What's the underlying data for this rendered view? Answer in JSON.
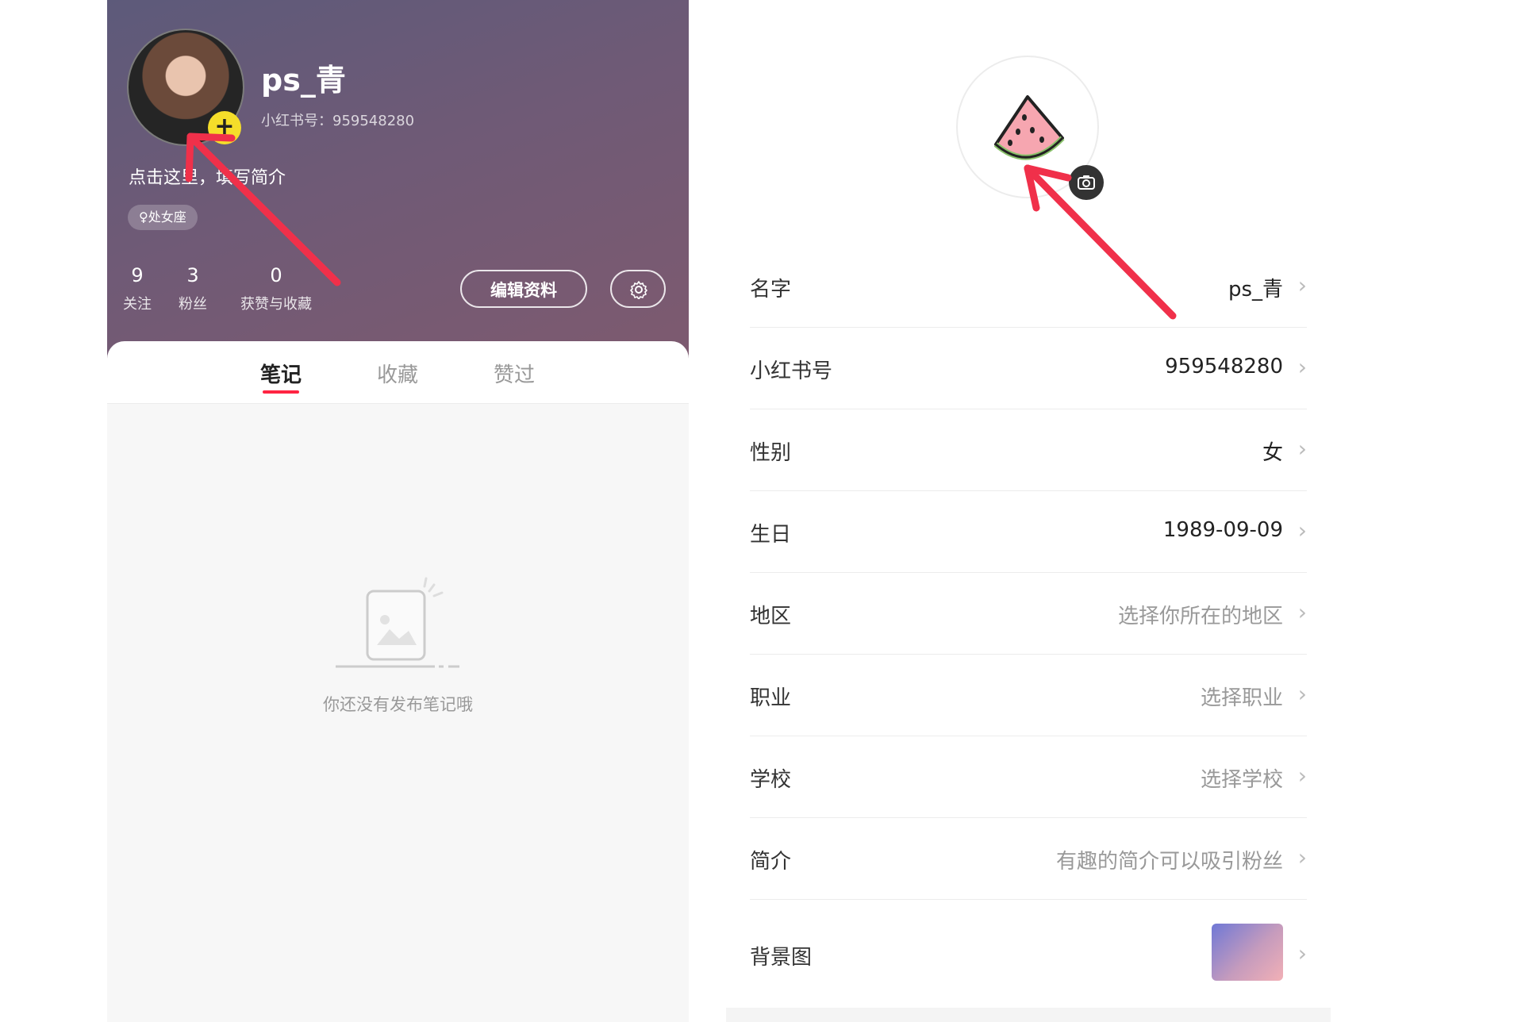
{
  "profile": {
    "username": "ps_青",
    "id_line": "小红书号：959548280",
    "bio_hint": "点击这里，填写简介",
    "zodiac_badge": "♀处女座",
    "avatar_add": "+",
    "stats": [
      {
        "value": "9",
        "label": "关注"
      },
      {
        "value": "3",
        "label": "粉丝"
      },
      {
        "value": "0",
        "label": "获赞与收藏"
      }
    ],
    "edit_button": "编辑资料"
  },
  "tabs": [
    {
      "label": "笔记",
      "active": true
    },
    {
      "label": "收藏",
      "active": false
    },
    {
      "label": "赞过",
      "active": false
    }
  ],
  "empty_state": {
    "text": "你还没有发布笔记哦",
    "icon": "empty-note-icon"
  },
  "edit_form": {
    "rows": [
      {
        "label": "名字",
        "value": "ps_青",
        "placeholder": false
      },
      {
        "label": "小红书号",
        "value": "959548280",
        "placeholder": false
      },
      {
        "label": "性别",
        "value": "女",
        "placeholder": false
      },
      {
        "label": "生日",
        "value": "1989-09-09",
        "placeholder": false
      },
      {
        "label": "地区",
        "value": "选择你所在的地区",
        "placeholder": true
      },
      {
        "label": "职业",
        "value": "选择职业",
        "placeholder": true
      },
      {
        "label": "学校",
        "value": "选择学校",
        "placeholder": true
      },
      {
        "label": "简介",
        "value": "有趣的简介可以吸引粉丝",
        "placeholder": true
      },
      {
        "label": "背景图",
        "value": "",
        "placeholder": false
      }
    ],
    "chevron": "›"
  },
  "colors": {
    "accent": "#ff2442",
    "arrow": "#f0304a",
    "badge_yellow": "#f5de2a"
  }
}
